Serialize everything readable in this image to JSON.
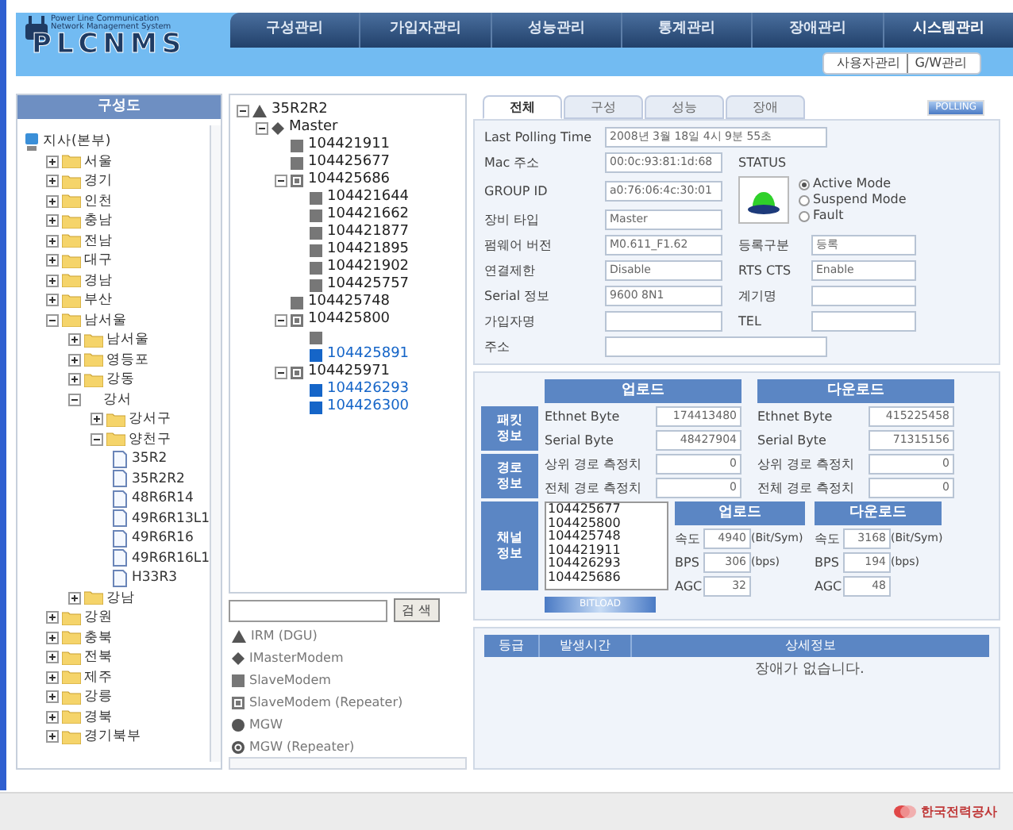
{
  "logo": {
    "tagline": [
      "Power Line Communication",
      "Network Management System"
    ],
    "name": "PLCNMS"
  },
  "nav": [
    {
      "label": "구성관리",
      "selected": false
    },
    {
      "label": "가입자관리",
      "selected": false
    },
    {
      "label": "성능관리",
      "selected": false
    },
    {
      "label": "통계관리",
      "selected": false
    },
    {
      "label": "장애관리",
      "selected": false
    },
    {
      "label": "시스템관리",
      "selected": true
    }
  ],
  "submenu": [
    "사용자관리",
    "G/W관리"
  ],
  "sidebar": {
    "title": "구성도",
    "tree": [
      {
        "label": "지사(본부)",
        "kind": "root",
        "children": [
          {
            "label": "서울",
            "kind": "folder",
            "expanded": false
          },
          {
            "label": "경기",
            "kind": "folder",
            "expanded": false
          },
          {
            "label": "인천",
            "kind": "folder",
            "expanded": false
          },
          {
            "label": "충남",
            "kind": "folder",
            "expanded": false
          },
          {
            "label": "전남",
            "kind": "folder",
            "expanded": false
          },
          {
            "label": "대구",
            "kind": "folder",
            "expanded": false
          },
          {
            "label": "경남",
            "kind": "folder",
            "expanded": false
          },
          {
            "label": "부산",
            "kind": "folder",
            "expanded": false
          },
          {
            "label": "남서울",
            "kind": "folder",
            "expanded": true,
            "children": [
              {
                "label": "남서울",
                "kind": "folder",
                "expanded": false
              },
              {
                "label": "영등포",
                "kind": "folder",
                "expanded": false
              },
              {
                "label": "강동",
                "kind": "folder",
                "expanded": false
              },
              {
                "label": "강서",
                "kind": "plain",
                "expanded": true,
                "children": [
                  {
                    "label": "강서구",
                    "kind": "folder",
                    "expanded": false
                  },
                  {
                    "label": "양천구",
                    "kind": "folder",
                    "expanded": true,
                    "children": [
                      {
                        "label": "35R2",
                        "kind": "file"
                      },
                      {
                        "label": "35R2R2",
                        "kind": "file"
                      },
                      {
                        "label": "48R6R14",
                        "kind": "file"
                      },
                      {
                        "label": "49R6R13L1",
                        "kind": "file"
                      },
                      {
                        "label": "49R6R16",
                        "kind": "file"
                      },
                      {
                        "label": "49R6R16L1",
                        "kind": "file"
                      },
                      {
                        "label": "H33R3",
                        "kind": "file"
                      }
                    ]
                  }
                ]
              },
              {
                "label": "강남",
                "kind": "folder",
                "expanded": false
              }
            ]
          },
          {
            "label": "강원",
            "kind": "folder",
            "expanded": false
          },
          {
            "label": "충북",
            "kind": "folder",
            "expanded": false
          },
          {
            "label": "전북",
            "kind": "folder",
            "expanded": false
          },
          {
            "label": "제주",
            "kind": "folder",
            "expanded": false
          },
          {
            "label": "강릉",
            "kind": "folder",
            "expanded": false
          },
          {
            "label": "경북",
            "kind": "folder",
            "expanded": false
          },
          {
            "label": "경기북부",
            "kind": "folder",
            "expanded": false
          }
        ]
      }
    ]
  },
  "device_tree": {
    "nodes": [
      {
        "label": "35R2R2",
        "kind": "irm",
        "expanded": true,
        "children": [
          {
            "label": "Master",
            "kind": "master",
            "expanded": true,
            "children": [
              {
                "label": "104421911",
                "kind": "slave",
                "highlighted": false
              },
              {
                "label": "104425677",
                "kind": "slave",
                "highlighted": false
              },
              {
                "label": "104425686",
                "kind": "repeater",
                "expanded": true,
                "children": [
                  {
                    "label": "104421644",
                    "kind": "slave",
                    "highlighted": false
                  },
                  {
                    "label": "104421662",
                    "kind": "slave",
                    "highlighted": false
                  },
                  {
                    "label": "104421877",
                    "kind": "slave",
                    "highlighted": false
                  },
                  {
                    "label": "104421895",
                    "kind": "slave",
                    "highlighted": false
                  },
                  {
                    "label": "104421902",
                    "kind": "slave",
                    "highlighted": false
                  },
                  {
                    "label": "104425757",
                    "kind": "slave",
                    "highlighted": false
                  }
                ]
              },
              {
                "label": "104425748",
                "kind": "slave",
                "highlighted": false
              },
              {
                "label": "104425800",
                "kind": "repeater",
                "expanded": true,
                "children": [
                  {
                    "kind": "slave",
                    "highlighted": false
                  },
                  {
                    "label": "104425891",
                    "kind": "slave",
                    "highlighted": true
                  }
                ]
              },
              {
                "label": "104425971",
                "kind": "repeater",
                "expanded": true,
                "children": [
                  {
                    "label": "104426293",
                    "kind": "slave",
                    "highlighted": true
                  },
                  {
                    "label": "104426300",
                    "kind": "slave",
                    "highlighted": true
                  }
                ]
              }
            ]
          }
        ]
      }
    ],
    "search_button": "검 색",
    "legend": [
      {
        "kind": "irm",
        "label": "IRM (DGU)"
      },
      {
        "kind": "master",
        "label": "IMasterModem"
      },
      {
        "kind": "slave",
        "label": "SlaveModem"
      },
      {
        "kind": "repeater",
        "label": "SlaveModem (Repeater)"
      },
      {
        "kind": "mgw",
        "label": "MGW"
      },
      {
        "kind": "mgw_repeater",
        "label": "MGW (Repeater)"
      }
    ]
  },
  "tabs": [
    {
      "label": "전체",
      "selected": true
    },
    {
      "label": "구성",
      "selected": false
    },
    {
      "label": "성능",
      "selected": false
    },
    {
      "label": "장애",
      "selected": false
    }
  ],
  "polling_button": "POLLING",
  "info": {
    "polling": {
      "label": "Last Polling Time",
      "value": "2008년 3월 18일 4시 9분 55초"
    },
    "left_fields": [
      {
        "label": "Mac 주소",
        "value": "00:0c:93:81:1d:68"
      },
      {
        "label": "GROUP ID",
        "value": "a0:76:06:4c:30:01"
      },
      {
        "label": "장비 타입",
        "value": "Master"
      }
    ],
    "status": {
      "label": "STATUS",
      "modes": [
        {
          "label": "Active Mode",
          "selected": true
        },
        {
          "label": "Suspend Mode",
          "selected": false
        },
        {
          "label": "Fault",
          "selected": false
        }
      ]
    },
    "pair_rows": [
      {
        "label": "펌웨어 버전",
        "value": "M0.611_F1.62",
        "label2": "등록구분",
        "value2": "등록"
      },
      {
        "label": "연결제한",
        "value": "Disable",
        "label2": "RTS CTS",
        "value2": "Enable"
      },
      {
        "label": "Serial 정보",
        "value": "9600 8N1",
        "label2": "계기명"
      },
      {
        "label": "가입자명",
        "label2": "TEL"
      }
    ],
    "address": {
      "label": "주소"
    }
  },
  "stats": {
    "upload_title": "업로드",
    "download_title": "다운로드",
    "groups": [
      {
        "label": "패킷 정보",
        "rows": [
          {
            "up_label": "Ethnet Byte",
            "up_value": "174413480",
            "down_label": "Ethnet Byte",
            "down_value": "415225458"
          },
          {
            "up_label": "Serial Byte",
            "up_value": "48427904",
            "down_label": "Serial Byte",
            "down_value": "71315156"
          }
        ]
      },
      {
        "label": "경로 정보",
        "rows": [
          {
            "up_label": "상위 경로 측정치",
            "up_value": "0",
            "down_label": "상위 경로 측정치",
            "down_value": "0"
          },
          {
            "up_label": "전체 경로 측정치",
            "up_value": "0",
            "down_label": "전체 경로 측정치",
            "down_value": "0"
          }
        ]
      }
    ]
  },
  "channel": {
    "label": "채널 정보",
    "modems": [
      "104425677",
      "104425800",
      "104425748",
      "104421911",
      "104426293",
      "104425686"
    ],
    "upload_title": "업로드",
    "download_title": "다운로드",
    "rows": [
      {
        "label": "속도",
        "up": "4940",
        "up_unit": "(Bit/Sym)",
        "down_label": "속도",
        "down": "3168",
        "down_unit": "(Bit/Sym)"
      },
      {
        "label": "BPS",
        "up": "306",
        "up_unit": "(bps)",
        "down_label": "BPS",
        "down": "194",
        "down_unit": "(bps)"
      },
      {
        "label": "AGC",
        "up": "32",
        "down_label": "AGC",
        "down": "48"
      }
    ],
    "button": "BITLOAD"
  },
  "events": {
    "columns": [
      "등급",
      "발생시간",
      "상세정보"
    ],
    "message": "장애가 없습니다."
  },
  "footer_logo": "한국전력공사"
}
